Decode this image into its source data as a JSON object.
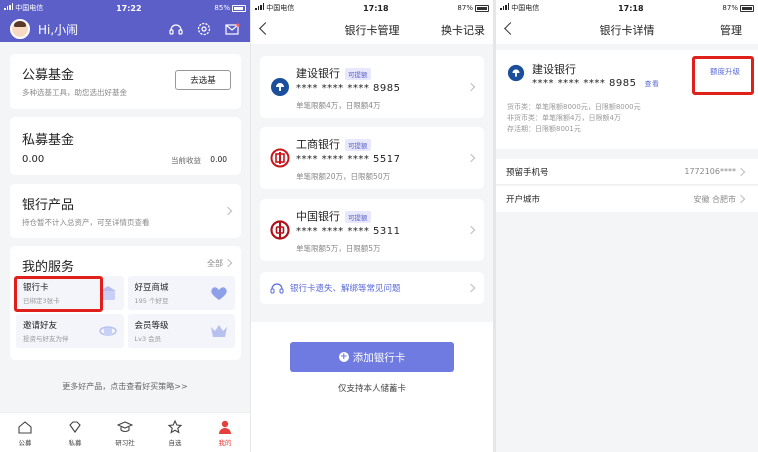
{
  "colors": {
    "primary": "#5b5fc7",
    "accent": "#6f7be0",
    "highlight": "#e0201b",
    "active_tab": "#e4413c"
  },
  "panel1": {
    "status": {
      "carrier": "中国电信",
      "time": "17:22",
      "battery": "85%"
    },
    "greeting": "Hi,小闹",
    "header_icons": [
      "service-icon",
      "settings-icon",
      "mail-icon"
    ],
    "public_fund": {
      "title": "公募基金",
      "subtitle": "多种选基工具，助您选出好基金",
      "button": "去选基"
    },
    "private_fund": {
      "title": "私募基金",
      "value": "0.00",
      "income_label": "当前收益",
      "income_value": "0.00"
    },
    "bank_products": {
      "title": "银行产品",
      "subtitle": "持仓暂不计入总资产，可至详情页查看"
    },
    "services": {
      "title": "我的服务",
      "all": "全部",
      "items": [
        {
          "name": "银行卡",
          "sub": "已绑定3张卡",
          "icon": "bank-card-icon"
        },
        {
          "name": "好豆商城",
          "sub": "195 个好豆",
          "icon": "heart-icon"
        },
        {
          "name": "邀请好友",
          "sub": "投资与好友为伴",
          "icon": "gift-icon"
        },
        {
          "name": "会员等级",
          "sub": "Lv3 会员",
          "icon": "crown-icon"
        }
      ]
    },
    "more_link": "更多好产品，点击查看好买策略>>",
    "tabs": [
      {
        "label": "公募",
        "icon": "home-icon"
      },
      {
        "label": "私募",
        "icon": "diamond-icon"
      },
      {
        "label": "研习社",
        "icon": "graduation-cap-icon"
      },
      {
        "label": "自选",
        "icon": "star-icon"
      },
      {
        "label": "我的",
        "icon": "user-icon"
      }
    ]
  },
  "panel2": {
    "status": {
      "carrier": "中国电信",
      "time": "17:18",
      "battery": "87%"
    },
    "title": "银行卡管理",
    "right_action": "换卡记录",
    "cards": [
      {
        "bank": "建设银行",
        "tag": "可提额",
        "number": "**** **** **** 8985",
        "limit": "单笔限额4万，日限额4万",
        "logo": "ccb-logo-icon"
      },
      {
        "bank": "工商银行",
        "tag": "可提额",
        "number": "**** **** **** 5517",
        "limit": "单笔限额20万，日限额50万",
        "logo": "icbc-logo-icon"
      },
      {
        "bank": "中国银行",
        "tag": "可提额",
        "number": "**** **** **** 5311",
        "limit": "单笔限额5万，日限额5万",
        "logo": "boc-logo-icon"
      }
    ],
    "faq": "银行卡遗失、解绑等常见问题",
    "add_button": "添加银行卡",
    "add_note": "仅支持本人储蓄卡"
  },
  "panel3": {
    "status": {
      "carrier": "中国电信",
      "time": "17:18",
      "battery": "87%"
    },
    "title": "银行卡详情",
    "right_action": "管理",
    "card": {
      "bank": "建设银行",
      "number": "**** **** **** 8985",
      "view": "查看",
      "upgrade": "额度升级",
      "limits": [
        "货币类：单笔限额8000元，日限额8000元",
        "非货币类：单笔限额4万，日限额4万",
        "存活期：日限额8001元"
      ]
    },
    "rows": [
      {
        "label": "预留手机号",
        "value": "1772106****"
      },
      {
        "label": "开户城市",
        "value": "安徽  合肥市"
      }
    ]
  }
}
